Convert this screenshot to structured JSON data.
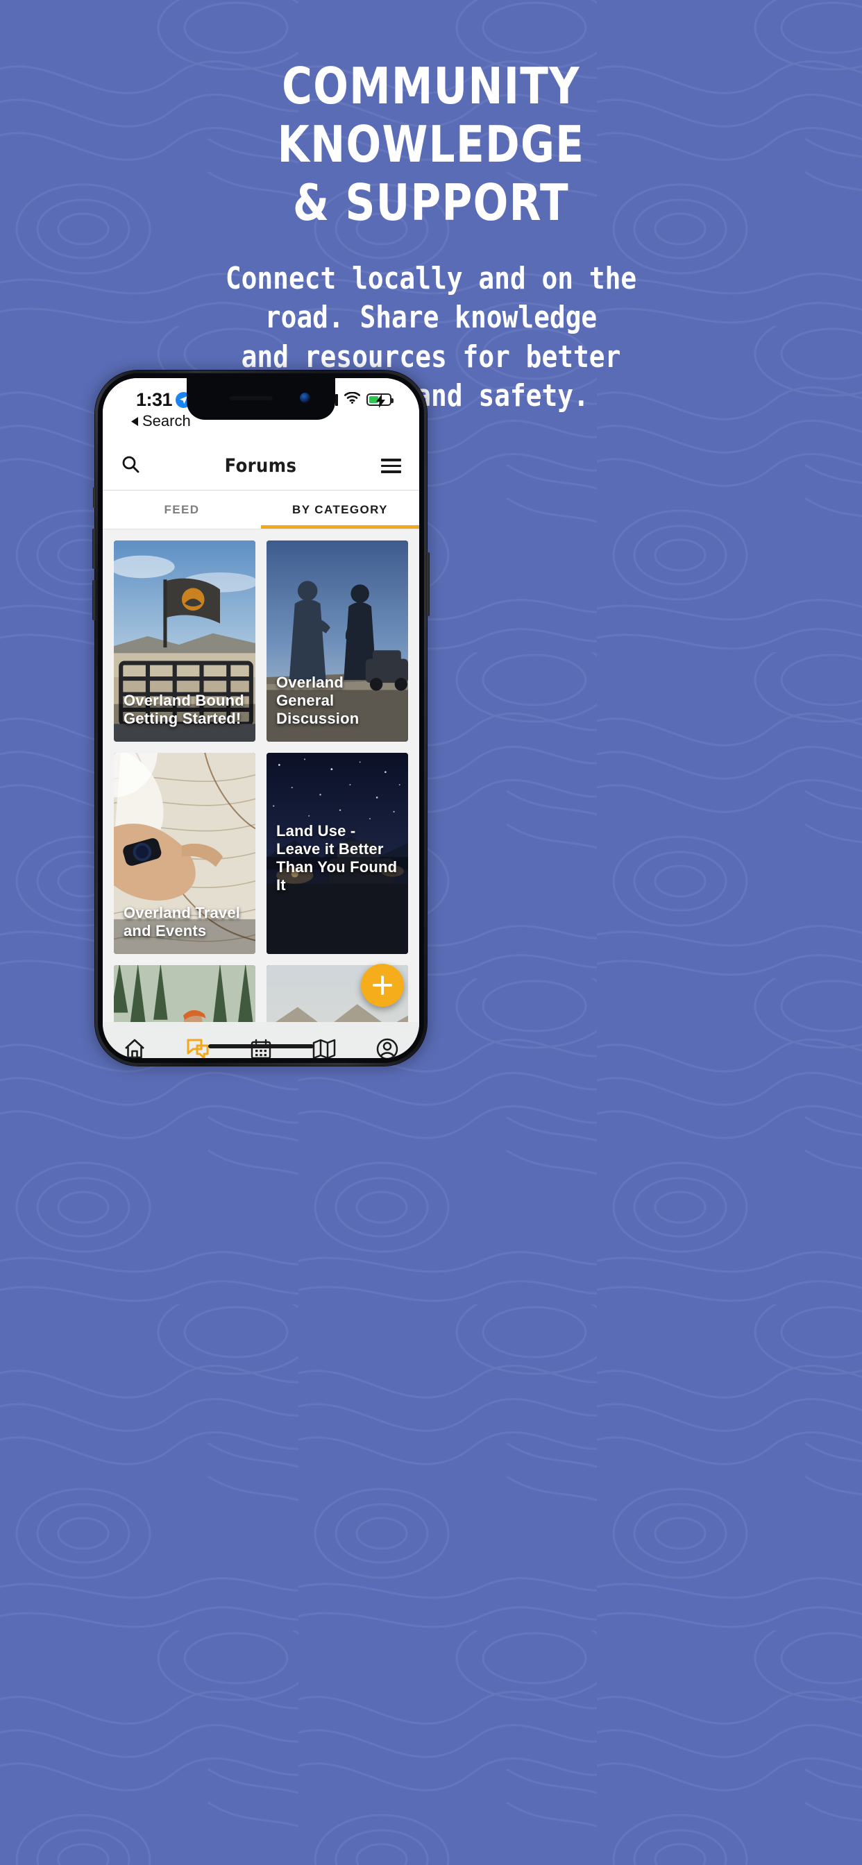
{
  "theme": {
    "background": "#5a6cb5",
    "accent": "#f2a81d",
    "fab": "#f5ad1b",
    "text_on_bg": "#ffffff"
  },
  "hero": {
    "headline_lines": [
      "COMMUNITY",
      "KNOWLEDGE",
      "& SUPPORT"
    ],
    "subhead_lines": [
      "Connect locally and on the",
      "road. Share knowledge",
      "and resources for better",
      "planning and safety."
    ]
  },
  "phone": {
    "status_bar": {
      "time": "1:31",
      "location_icon": "location-arrow-icon",
      "back_label": "Search",
      "back_icon": "back-triangle-icon",
      "signal_icon": "cellular-signal-icon",
      "wifi_icon": "wifi-icon",
      "battery_icon": "battery-charging-icon"
    },
    "app_header": {
      "search_icon": "search-icon",
      "title": "Forums",
      "menu_icon": "hamburger-menu-icon"
    },
    "tabs": [
      {
        "label": "FEED",
        "active": false
      },
      {
        "label": "BY CATEGORY",
        "active": true
      }
    ],
    "categories": [
      {
        "title": "Overland Bound Getting Started!",
        "title_position": "bottom"
      },
      {
        "title": "Overland General Discussion",
        "title_position": "bottom"
      },
      {
        "title": "Overland Travel and Events",
        "title_position": "bottom"
      },
      {
        "title": "Land Use - Leave it Better Than You Found It",
        "title_position": "mid"
      },
      {
        "title": "",
        "title_position": "bottom"
      },
      {
        "title": "",
        "title_position": "bottom"
      }
    ],
    "fab": {
      "icon": "plus-icon",
      "label": "+"
    },
    "bottom_nav": [
      {
        "icon": "home-icon",
        "active": false
      },
      {
        "icon": "forums-chat-icon",
        "active": true
      },
      {
        "icon": "calendar-icon",
        "active": false
      },
      {
        "icon": "map-icon",
        "active": false
      },
      {
        "icon": "account-circle-icon",
        "active": false
      }
    ]
  }
}
